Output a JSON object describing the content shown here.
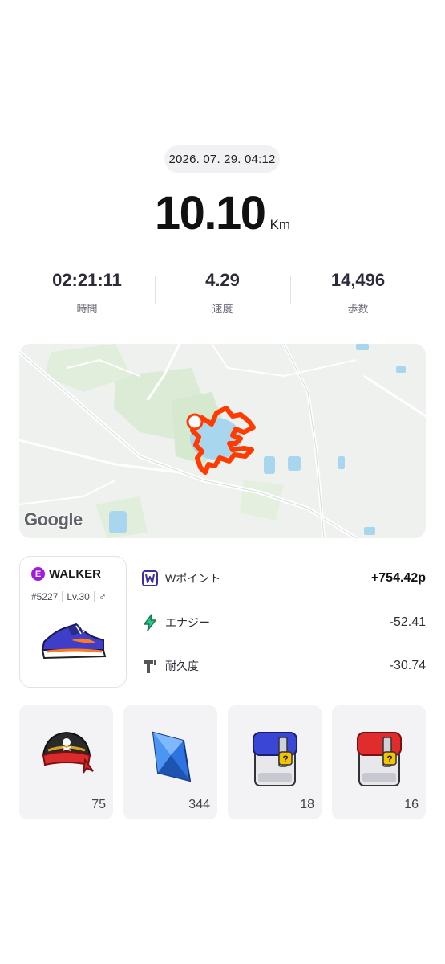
{
  "activity": {
    "datetime": "2026. 07. 29. 04:12",
    "distance": "10.10",
    "distance_unit": "Km"
  },
  "stats": [
    {
      "value": "02:21:11",
      "label": "時間"
    },
    {
      "value": "4.29",
      "label": "速度"
    },
    {
      "value": "14,496",
      "label": "歩数"
    }
  ],
  "map": {
    "attribution": "Google",
    "route_color": "#ff3b00"
  },
  "walker": {
    "badge": "E",
    "name": "WALKER",
    "id": "#5227",
    "level": "Lv.30",
    "gender_icon": "male-icon",
    "badge_color": "#a21bdc"
  },
  "rewards": [
    {
      "icon": "w-point-icon",
      "label": "Wポイント",
      "value": "+754.42p"
    },
    {
      "icon": "lightning-icon",
      "label": "エナジー",
      "value": "-52.41"
    },
    {
      "icon": "durability-icon",
      "label": "耐久度",
      "value": "-30.74"
    }
  ],
  "items": [
    {
      "icon": "pirate-hat-icon",
      "count": "75"
    },
    {
      "icon": "blue-crystal-icon",
      "count": "344"
    },
    {
      "icon": "blue-mystery-box-icon",
      "count": "18"
    },
    {
      "icon": "red-mystery-box-icon",
      "count": "16"
    }
  ]
}
